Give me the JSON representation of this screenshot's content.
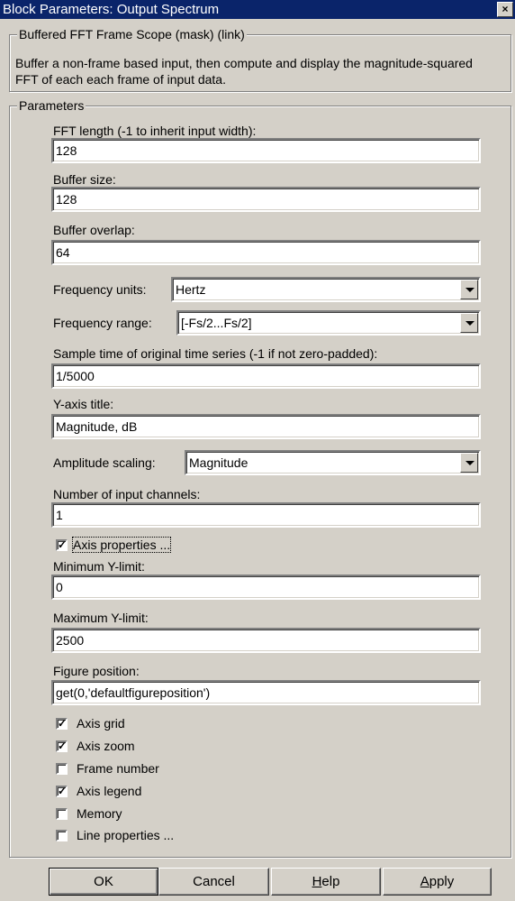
{
  "window": {
    "title": "Block Parameters: Output  Spectrum",
    "close": "×"
  },
  "mask": {
    "group_title": "Buffered FFT Frame Scope (mask) (link)",
    "description": "Buffer a non-frame based input, then compute and display the magnitude-squared FFT of each each frame of input data."
  },
  "params": {
    "group_title": "Parameters",
    "fft_length": {
      "label": "FFT length (-1 to inherit input width):",
      "value": "128"
    },
    "buffer_size": {
      "label": "Buffer size:",
      "value": "128"
    },
    "buffer_overlap": {
      "label": "Buffer overlap:",
      "value": "64"
    },
    "frequency_units": {
      "label": "Frequency units:",
      "value": "Hertz"
    },
    "frequency_range": {
      "label": "Frequency range:",
      "value": "[-Fs/2...Fs/2]"
    },
    "sample_time": {
      "label": "Sample time of original time series (-1 if not zero-padded):",
      "value": "1/5000"
    },
    "y_axis_title": {
      "label": "Y-axis title:",
      "value": "Magnitude, dB"
    },
    "amplitude_scaling": {
      "label": "Amplitude scaling:",
      "value": "Magnitude"
    },
    "num_channels": {
      "label": "Number of input channels:",
      "value": "1"
    },
    "axis_properties": {
      "label": "Axis properties ...",
      "checked": true
    },
    "min_y": {
      "label": "Minimum Y-limit:",
      "value": "0"
    },
    "max_y": {
      "label": "Maximum Y-limit:",
      "value": "2500"
    },
    "figure_position": {
      "label": "Figure position:",
      "value": "get(0,'defaultfigureposition')"
    },
    "checks": [
      {
        "label": "Axis grid",
        "checked": true
      },
      {
        "label": "Axis zoom",
        "checked": true
      },
      {
        "label": "Frame number",
        "checked": false
      },
      {
        "label": "Axis legend",
        "checked": true
      },
      {
        "label": "Memory",
        "checked": false
      },
      {
        "label": "Line properties ...",
        "checked": false
      }
    ]
  },
  "buttons": {
    "ok": "OK",
    "cancel": "Cancel",
    "help": "Help",
    "apply": "Apply"
  },
  "check_mark": "✓"
}
